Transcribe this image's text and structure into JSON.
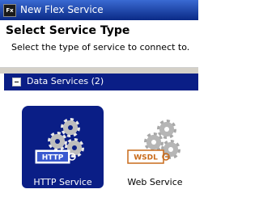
{
  "window": {
    "title": "New Flex Service",
    "app_icon_text": "Fx"
  },
  "header": {
    "heading": "Select Service Type",
    "description": "Select the type of service to connect to."
  },
  "section": {
    "title": "Data Services (2)"
  },
  "services": [
    {
      "label": "HTTP Service",
      "badge": "HTTP",
      "selected": true
    },
    {
      "label": "Web Service",
      "badge": "WSDL",
      "selected": false
    }
  ],
  "colors": {
    "titlebar": "#0a2a86",
    "selection": "#0a1e86",
    "section_bar": "#0a1e86",
    "wsdl_badge": "#c86a1a"
  }
}
